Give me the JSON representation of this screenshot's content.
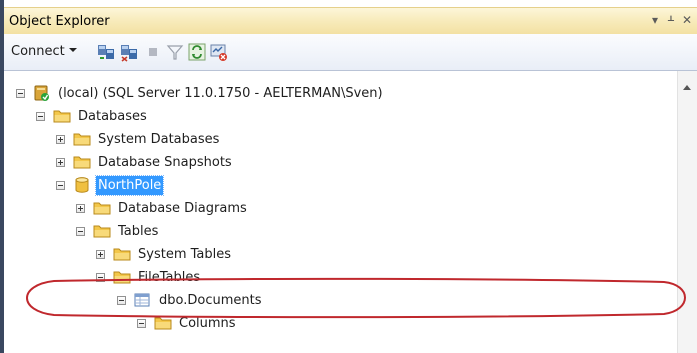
{
  "window": {
    "title": "Object Explorer",
    "pin_glyph": "▾ ⊓ ✕"
  },
  "toolbar": {
    "connect_label": "Connect",
    "buttons": [
      "connect-object-explorer-icon",
      "disconnect-icon",
      "stop-icon",
      "filter-icon",
      "refresh-icon",
      "activity-monitor-icon"
    ]
  },
  "tree": {
    "server": "(local) (SQL Server 11.0.1750 - AELTERMAN\\Sven)",
    "databases": "Databases",
    "system_databases": "System Databases",
    "database_snapshots": "Database Snapshots",
    "northpole": "NorthPole",
    "database_diagrams": "Database Diagrams",
    "tables": "Tables",
    "system_tables": "System Tables",
    "filetables": "FileTables",
    "dbo_documents": "dbo.Documents",
    "columns": "Columns"
  },
  "colors": {
    "title_bar": "#f8ecbd",
    "selection": "#3399ff",
    "highlight_ellipse": "#c0282d",
    "folder": "#f3c74a"
  }
}
